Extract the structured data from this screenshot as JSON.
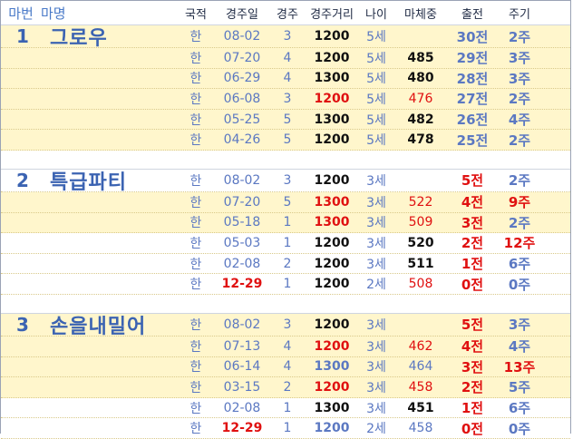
{
  "header": {
    "no": "마번",
    "name": "마명",
    "nat": "국적",
    "date": "경주일",
    "race": "경주",
    "dist": "경주거리",
    "age": "나이",
    "weight": "마체중",
    "start": "출전",
    "week": "주기"
  },
  "horses": [
    {
      "no": "1",
      "name": "그로우",
      "rows": [
        {
          "nat": "한",
          "date": "08-02",
          "race": "3",
          "dist": "1200",
          "age": "5세",
          "weight": "",
          "start": "30전",
          "week": "2주"
        },
        {
          "nat": "한",
          "date": "07-20",
          "race": "4",
          "dist": "1200",
          "age": "5세",
          "weight": "485",
          "start": "29전",
          "week": "3주"
        },
        {
          "nat": "한",
          "date": "06-29",
          "race": "4",
          "dist": "1300",
          "age": "5세",
          "weight": "480",
          "start": "28전",
          "week": "3주"
        },
        {
          "nat": "한",
          "date": "06-08",
          "race": "3",
          "dist": "1200",
          "age": "5세",
          "weight": "476",
          "start": "27전",
          "week": "2주"
        },
        {
          "nat": "한",
          "date": "05-25",
          "race": "5",
          "dist": "1300",
          "age": "5세",
          "weight": "482",
          "start": "26전",
          "week": "4주"
        },
        {
          "nat": "한",
          "date": "04-26",
          "race": "5",
          "dist": "1200",
          "age": "5세",
          "weight": "478",
          "start": "25전",
          "week": "2주"
        }
      ]
    },
    {
      "no": "2",
      "name": "특급파티",
      "rows": [
        {
          "nat": "한",
          "date": "08-02",
          "race": "3",
          "dist": "1200",
          "age": "3세",
          "weight": "",
          "start": "5전",
          "week": "2주"
        },
        {
          "nat": "한",
          "date": "07-20",
          "race": "5",
          "dist": "1300",
          "age": "3세",
          "weight": "522",
          "start": "4전",
          "week": "9주"
        },
        {
          "nat": "한",
          "date": "05-18",
          "race": "1",
          "dist": "1300",
          "age": "3세",
          "weight": "509",
          "start": "3전",
          "week": "2주"
        },
        {
          "nat": "한",
          "date": "05-03",
          "race": "1",
          "dist": "1200",
          "age": "3세",
          "weight": "520",
          "start": "2전",
          "week": "12주"
        },
        {
          "nat": "한",
          "date": "02-08",
          "race": "2",
          "dist": "1200",
          "age": "3세",
          "weight": "511",
          "start": "1전",
          "week": "6주"
        },
        {
          "nat": "한",
          "date": "12-29",
          "race": "1",
          "dist": "1200",
          "age": "2세",
          "weight": "508",
          "start": "0전",
          "week": "0주"
        }
      ]
    },
    {
      "no": "3",
      "name": "손을내밀어",
      "rows": [
        {
          "nat": "한",
          "date": "08-02",
          "race": "3",
          "dist": "1200",
          "age": "3세",
          "weight": "",
          "start": "5전",
          "week": "3주"
        },
        {
          "nat": "한",
          "date": "07-13",
          "race": "4",
          "dist": "1200",
          "age": "3세",
          "weight": "462",
          "start": "4전",
          "week": "4주"
        },
        {
          "nat": "한",
          "date": "06-14",
          "race": "4",
          "dist": "1300",
          "age": "3세",
          "weight": "464",
          "start": "3전",
          "week": "13주"
        },
        {
          "nat": "한",
          "date": "03-15",
          "race": "2",
          "dist": "1200",
          "age": "3세",
          "weight": "458",
          "start": "2전",
          "week": "5주"
        },
        {
          "nat": "한",
          "date": "02-08",
          "race": "1",
          "dist": "1300",
          "age": "3세",
          "weight": "451",
          "start": "1전",
          "week": "6주"
        },
        {
          "nat": "한",
          "date": "12-29",
          "race": "1",
          "dist": "1200",
          "age": "2세",
          "weight": "458",
          "start": "0전",
          "week": "0주"
        }
      ]
    }
  ],
  "colors": {
    "blue": "#5b78c2",
    "red": "#e01010",
    "highlight": "#fff6cc",
    "black": "#111111"
  }
}
